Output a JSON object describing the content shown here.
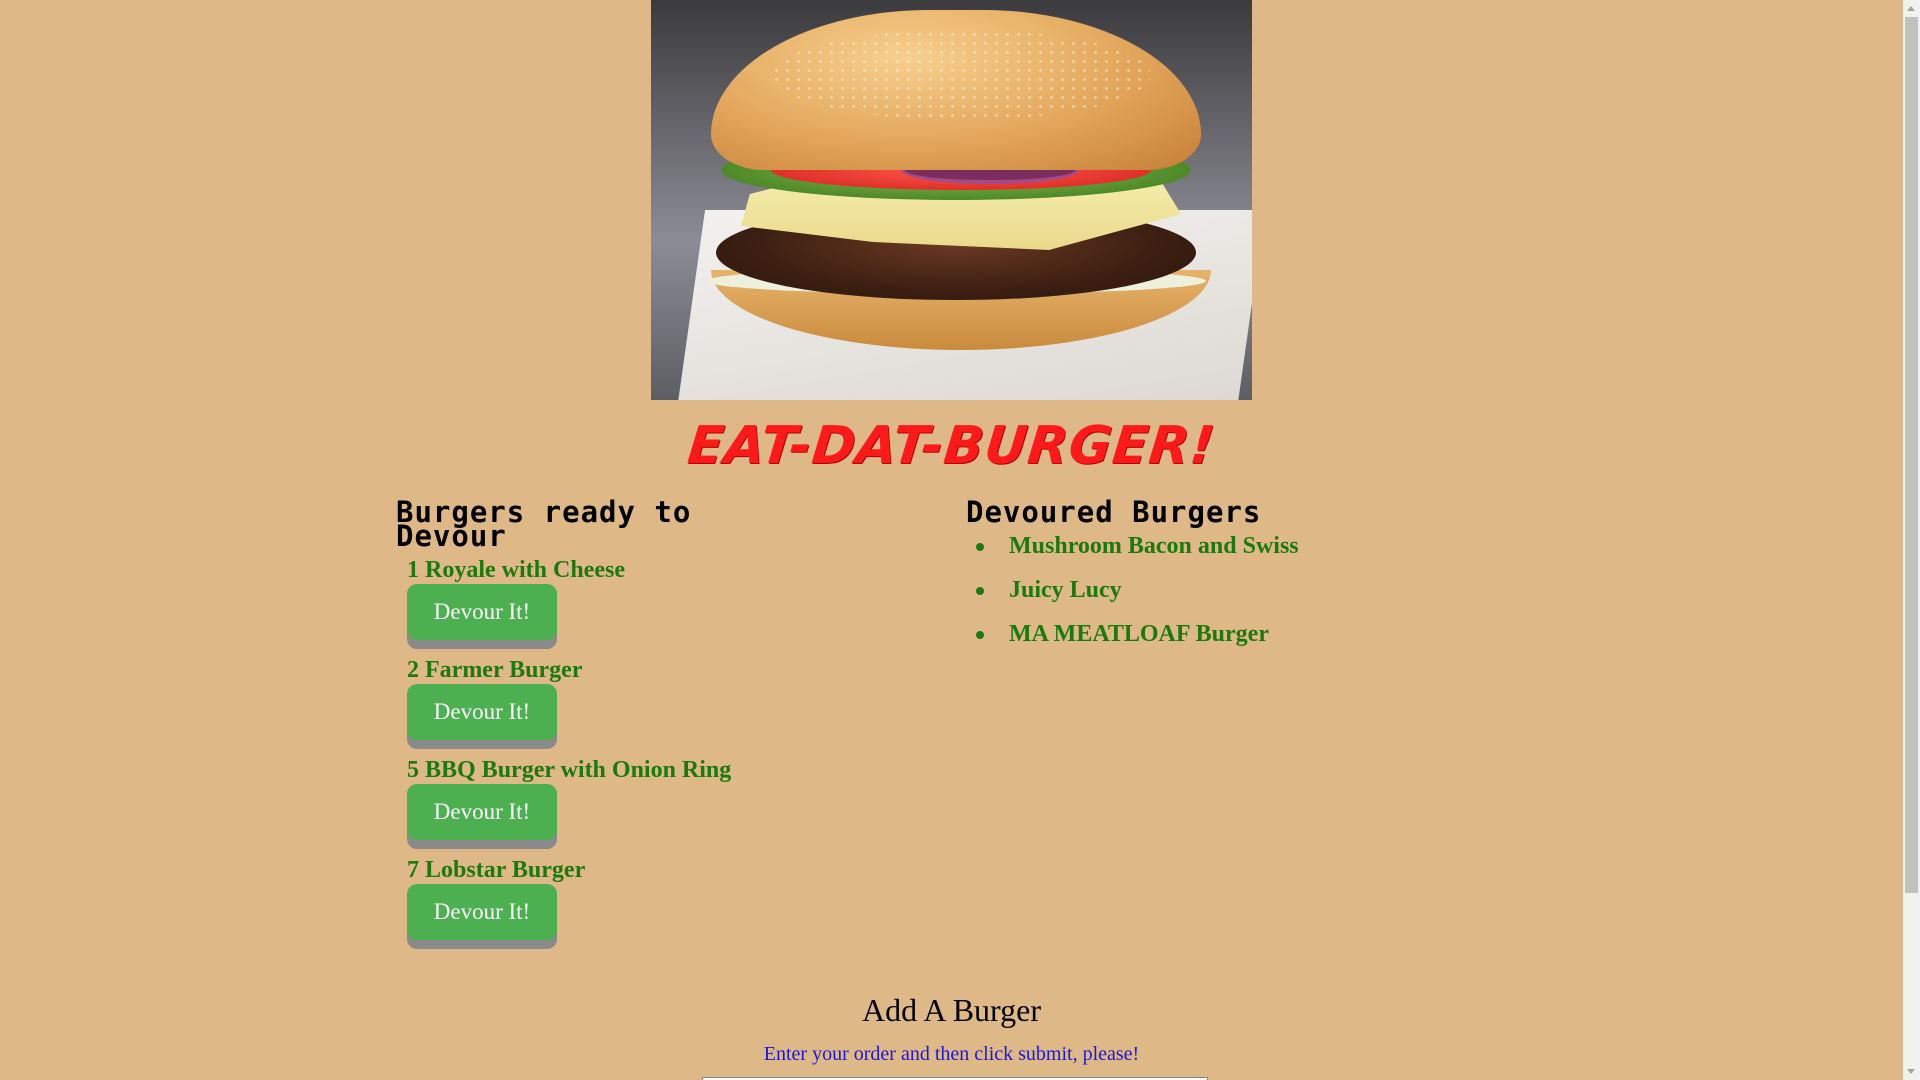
{
  "hero": {
    "image_alt": "burger-photo"
  },
  "header": {
    "brand": "EAT-DAT-BURGER!"
  },
  "ready": {
    "title": "Burgers ready to Devour",
    "items": [
      {
        "id": "1",
        "name": "Royale with Cheese",
        "label": "1 Royale with Cheese",
        "button": "Devour It!"
      },
      {
        "id": "2",
        "name": "Farmer Burger",
        "label": "2 Farmer Burger",
        "button": "Devour It!"
      },
      {
        "id": "5",
        "name": "BBQ Burger with Onion Ring",
        "label": "5 BBQ Burger with Onion Ring",
        "button": "Devour It!"
      },
      {
        "id": "7",
        "name": "Lobstar Burger",
        "label": "7 Lobstar Burger",
        "button": "Devour It!"
      }
    ]
  },
  "devoured": {
    "title": "Devoured Burgers",
    "items": [
      "Mushroom Bacon and Swiss",
      "Juicy Lucy",
      "MA MEATLOAF Burger"
    ]
  },
  "add": {
    "title": "Add A Burger",
    "help": "Enter your order and then click submit, please!"
  },
  "colors": {
    "background": "#DEB887",
    "brand": "#FF1A1A",
    "item_text": "#1B7A0E",
    "button": "#4CAF50",
    "help_text": "#1A1AD6"
  }
}
